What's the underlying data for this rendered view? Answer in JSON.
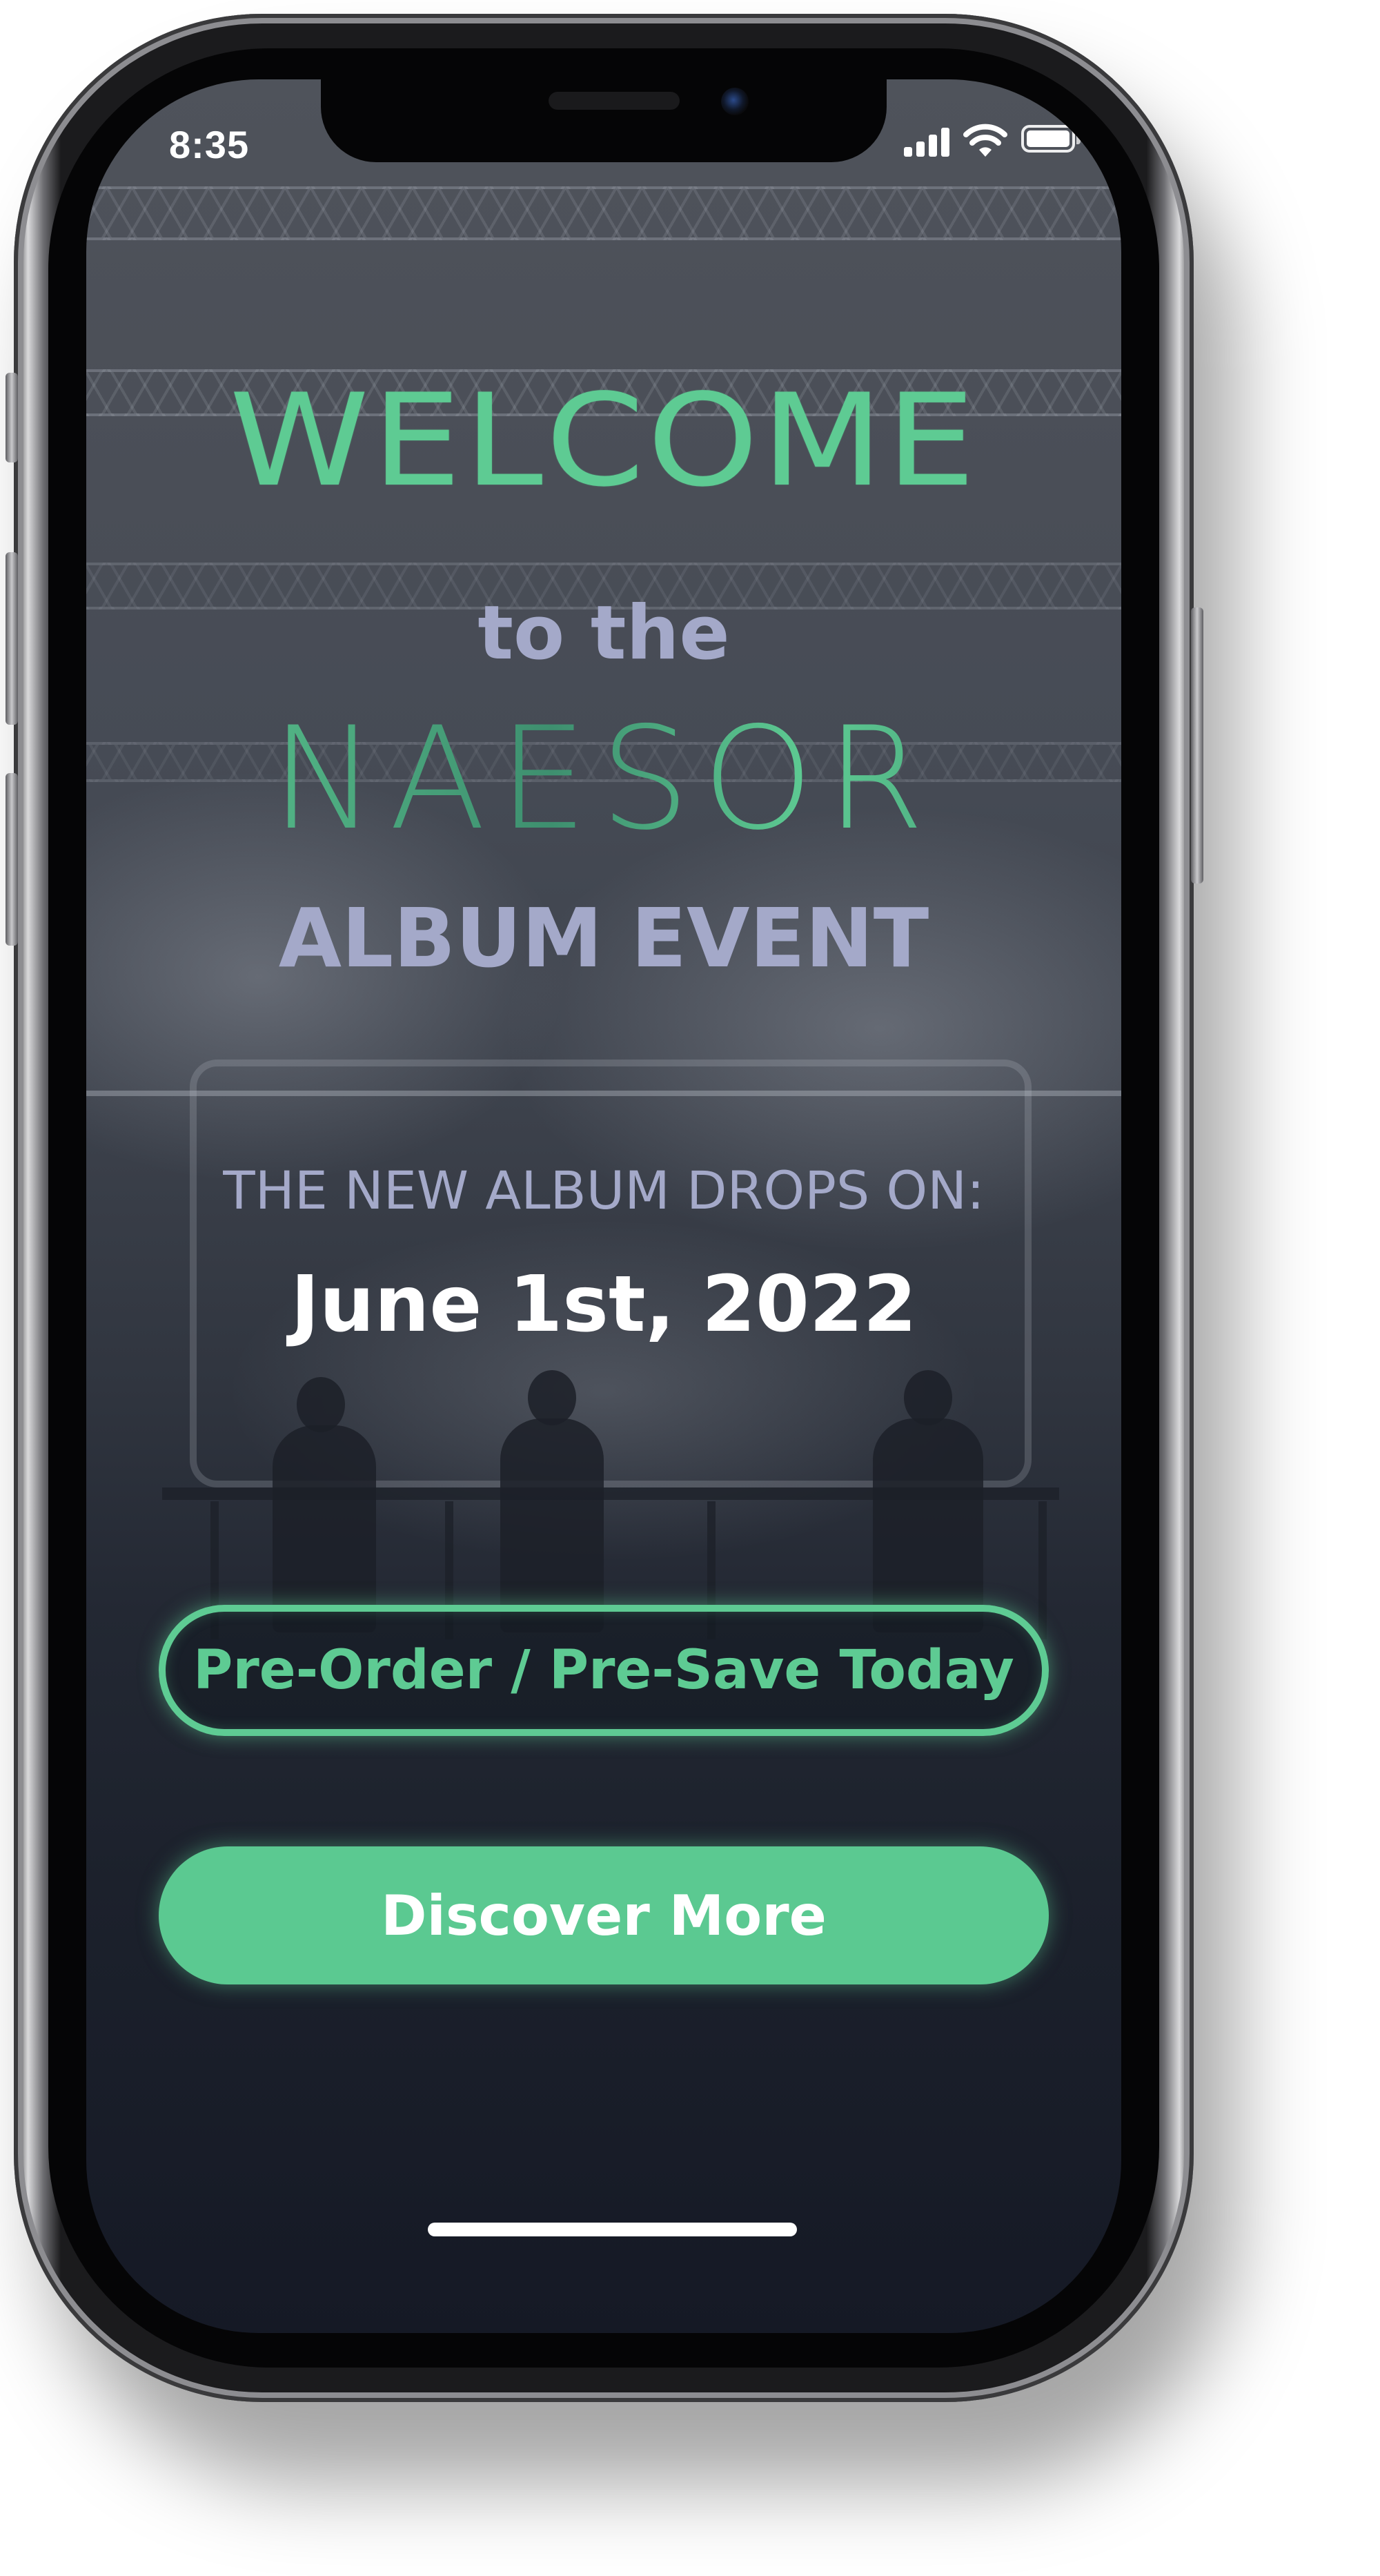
{
  "status_bar": {
    "time": "8:35",
    "icons": [
      "signal-icon",
      "wifi-icon",
      "battery-icon"
    ]
  },
  "hero": {
    "welcome": "WELCOME",
    "to_the": "to the",
    "brand": "NAESOR",
    "event": "ALBUM EVENT"
  },
  "release": {
    "label": "THE NEW ALBUM DROPS ON:",
    "date": "June 1st, 2022"
  },
  "actions": {
    "preorder_label": "Pre-Order / Pre-Save Today",
    "discover_label": "Discover More"
  },
  "colors": {
    "accent": "#5ecb93",
    "subtitle": "#a4a9c9",
    "text": "#ffffff",
    "background_top": "#4f535b",
    "background_bottom": "#151925"
  }
}
